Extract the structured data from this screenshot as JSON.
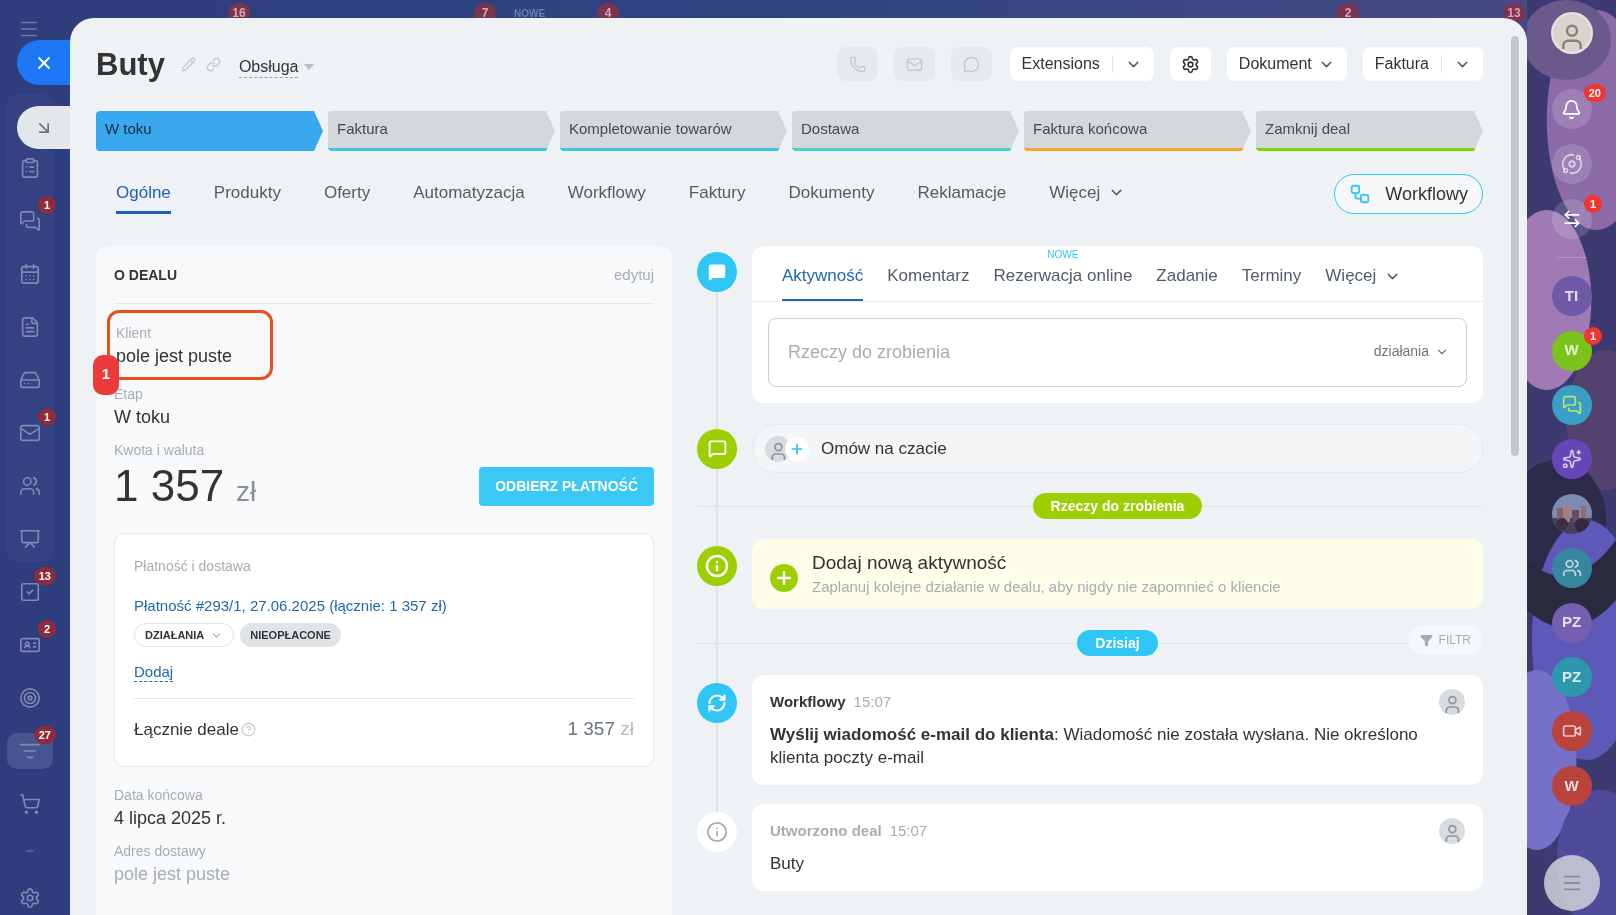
{
  "background_badges": [
    {
      "text": "16"
    },
    {
      "text": "7"
    },
    {
      "text": "NOWE"
    },
    {
      "text": "4"
    },
    {
      "text": "2"
    },
    {
      "text": "13"
    }
  ],
  "left_nav": {
    "items": [
      {
        "kind": "list",
        "selected": false
      },
      {
        "kind": "chat",
        "badge": "1",
        "selected": false
      },
      {
        "kind": "calendar",
        "selected": false
      },
      {
        "kind": "document",
        "selected": false
      },
      {
        "kind": "drive",
        "selected": false
      },
      {
        "kind": "mail",
        "badge": "1",
        "selected": false
      },
      {
        "kind": "contacts",
        "selected": false
      },
      {
        "kind": "presentation",
        "selected": false
      },
      {
        "kind": "tasks",
        "badge": "13",
        "selected": false
      },
      {
        "kind": "card",
        "badge": "2",
        "selected": false
      },
      {
        "kind": "target",
        "selected": false
      },
      {
        "kind": "funnel",
        "badge": "27",
        "selected": true
      },
      {
        "kind": "cart",
        "selected": false
      },
      {
        "kind": "more",
        "selected": false
      },
      {
        "kind": "gear",
        "selected": false
      }
    ]
  },
  "header": {
    "title": "Buty",
    "category": "Obsługa",
    "quick_actions": [
      {
        "kind": "phone",
        "disabled": true
      },
      {
        "kind": "mail",
        "disabled": true
      },
      {
        "kind": "chat",
        "disabled": true
      }
    ],
    "buttons": [
      {
        "kind": "split",
        "label": "Extensions"
      },
      {
        "kind": "settings"
      },
      {
        "kind": "dropdown",
        "label": "Dokument"
      },
      {
        "kind": "split",
        "label": "Faktura"
      }
    ]
  },
  "stages": [
    {
      "label": "W toku",
      "selected": true,
      "color": "#3aa8ee"
    },
    {
      "label": "Faktura",
      "selected": false,
      "color": "#39c6e0"
    },
    {
      "label": "Kompletowanie towarów",
      "selected": false,
      "color": "#39c6e0"
    },
    {
      "label": "Dostawa",
      "selected": false,
      "color": "#47d1c0"
    },
    {
      "label": "Faktura końcowa",
      "selected": false,
      "color": "#f5a623"
    },
    {
      "label": "Zamknij deal",
      "selected": false,
      "color": "#7bd500"
    }
  ],
  "tabs": [
    {
      "label": "Ogólne",
      "selected": true,
      "kind": "link"
    },
    {
      "label": "Produkty",
      "selected": false,
      "kind": "link"
    },
    {
      "label": "Oferty",
      "selected": false,
      "kind": "link"
    },
    {
      "label": "Automatyzacja",
      "selected": false,
      "kind": "link"
    },
    {
      "label": "Workflowy",
      "selected": false,
      "kind": "link"
    },
    {
      "label": "Faktury",
      "selected": false,
      "kind": "link"
    },
    {
      "label": "Dokumenty",
      "selected": false,
      "kind": "link"
    },
    {
      "label": "Reklamacje",
      "selected": false,
      "kind": "link"
    },
    {
      "label": "Więcej",
      "selected": false,
      "kind": "menu"
    }
  ],
  "workflow_button": {
    "label": "Workflowy"
  },
  "deal_card": {
    "title": "O DEALU",
    "edit": "edytuj",
    "client": {
      "label": "Klient",
      "value": "pole jest puste",
      "highlighted": true,
      "marker": "1"
    },
    "stage": {
      "label": "Etap",
      "value": "W toku"
    },
    "amount": {
      "label": "Kwota i waluta",
      "value": "1 357",
      "currency": "zł",
      "button": "ODBIERZ PŁATNOŚĆ"
    },
    "payment": {
      "title": "Płatność i dostawa",
      "link": "Płatność #293/1, 27.06.2025 (łącznie: 1 357 zł)",
      "actions": "DZIAŁANIA",
      "status": "NIEOPŁACONE",
      "add": "Dodaj",
      "total_label": "Łącznie deale",
      "total_value": "1 357",
      "total_currency": "zł"
    },
    "fields": [
      {
        "label": "Data końcowa",
        "value": "4 lipca 2025 r.",
        "empty": false
      },
      {
        "label": "Adres dostawy",
        "value": "pole jest puste",
        "empty": true
      }
    ]
  },
  "timeline": {
    "composer": {
      "tabs": [
        {
          "label": "Aktywność",
          "selected": true,
          "kind": "link"
        },
        {
          "label": "Komentarz",
          "selected": false,
          "kind": "link"
        },
        {
          "label": "Rezerwacja online",
          "selected": false,
          "kind": "link",
          "badge": "NOWE"
        },
        {
          "label": "Zadanie",
          "selected": false,
          "kind": "link"
        },
        {
          "label": "Terminy",
          "selected": false,
          "kind": "link"
        },
        {
          "label": "Więcej",
          "selected": false,
          "kind": "menu"
        }
      ],
      "placeholder": "Rzeczy do zrobienia",
      "actions": "działania"
    },
    "chat": {
      "label": "Omów na czacie"
    },
    "todo_divider": "Rzeczy do zrobienia",
    "add_activity": {
      "title": "Dodaj nową aktywność",
      "subtitle": "Zaplanuj kolejne działanie w dealu, aby nigdy nie zapomnieć o kliencie"
    },
    "today_divider": "Dzisiaj",
    "filter": "FILTR",
    "events": [
      {
        "kind": "workflow",
        "title": "Workflowy",
        "time": "15:07",
        "body": "**Wyślij wiadomość e-mail do klienta**: Wiadomość nie została wysłana. Nie określono klienta poczty e-mail"
      },
      {
        "kind": "created",
        "title": "Utworzono deal",
        "time": "15:07",
        "body": "Buty"
      }
    ]
  },
  "right_bar": {
    "notifications": "20",
    "items": [
      {
        "kind": "copilot"
      },
      {
        "kind": "sync-chat",
        "badge": "1"
      },
      {
        "kind": "divider"
      },
      {
        "kind": "initials",
        "label": "TI",
        "color": "#6f5aa8"
      },
      {
        "kind": "initials",
        "label": "W",
        "color": "#7bc21b",
        "badge": "1"
      },
      {
        "kind": "chats",
        "color": "#3a9fc4"
      },
      {
        "kind": "swirl",
        "color": "#6448b8"
      },
      {
        "kind": "picture"
      },
      {
        "kind": "group",
        "color": "#35869e"
      },
      {
        "kind": "initials",
        "label": "PZ",
        "color": "#7560b0"
      },
      {
        "kind": "initials",
        "label": "PZ",
        "color": "#2d98ad"
      },
      {
        "kind": "video",
        "color": "#b9443e"
      },
      {
        "kind": "initials",
        "label": "W",
        "color": "#b9443e"
      }
    ]
  }
}
